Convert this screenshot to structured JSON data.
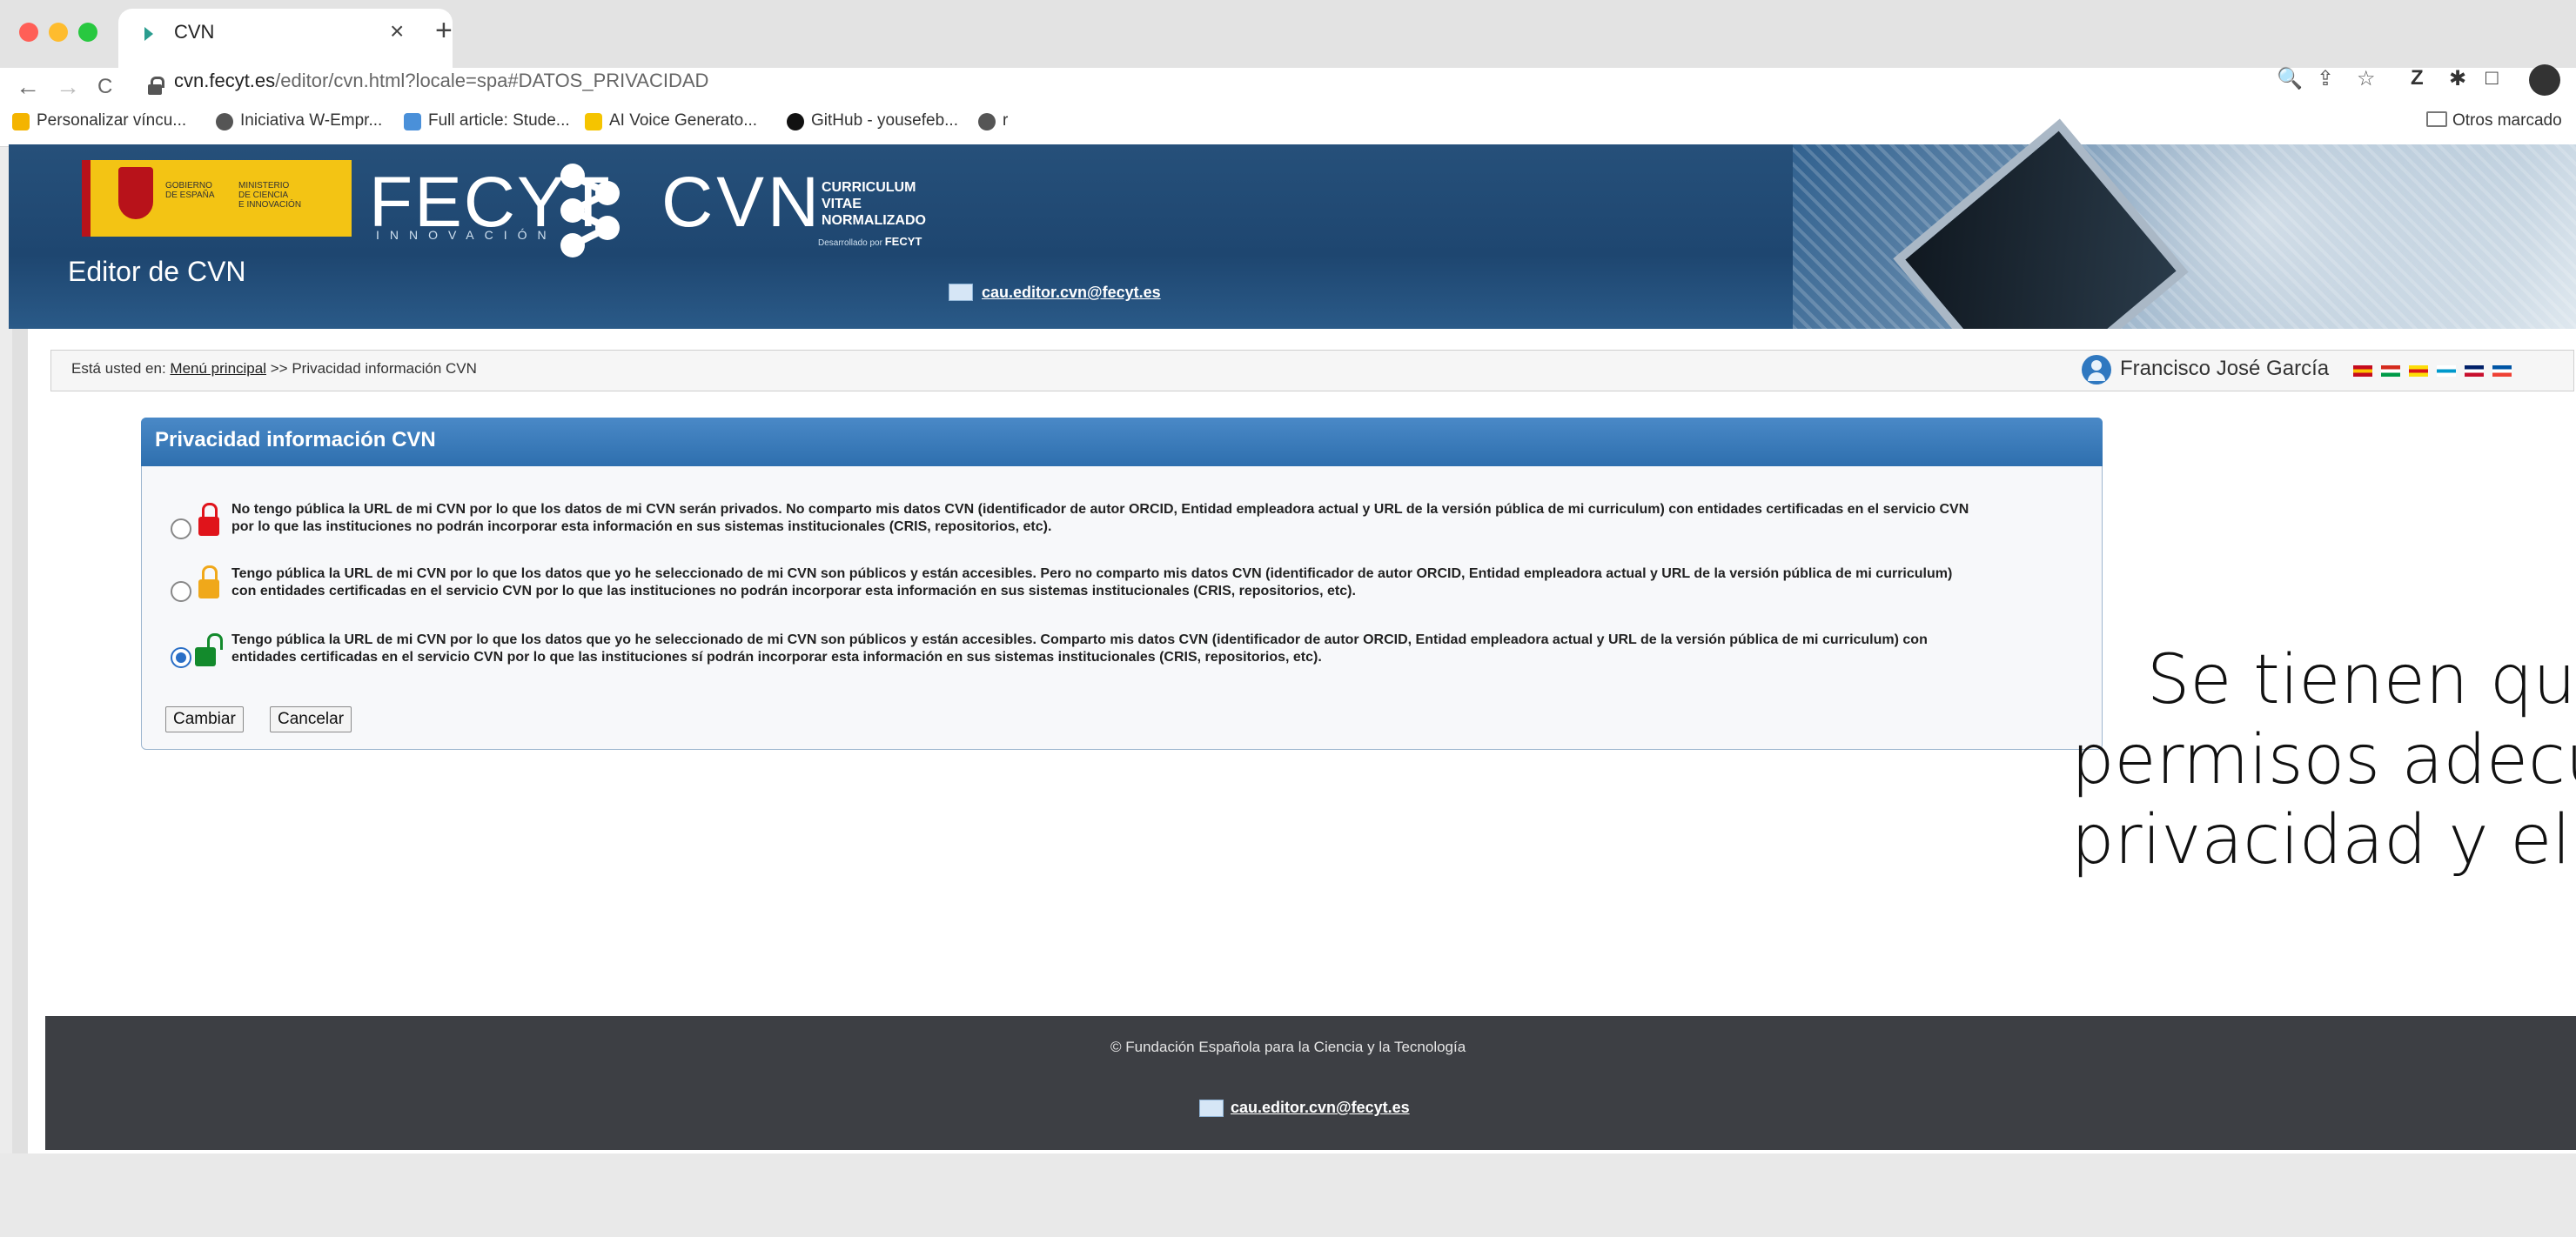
{
  "browser": {
    "tab_title": "CVN",
    "tab_close": "×",
    "tab_new": "+",
    "nav_back": "←",
    "nav_forward": "→",
    "nav_reload": "C",
    "url_domain": "cvn.fecyt.es",
    "url_path": "/editor/cvn.html?locale=spa#DATOS_PRIVACIDAD",
    "toolbar_icons": [
      "search-icon",
      "share-icon",
      "star-icon",
      "extension-z-icon",
      "puzzle-icon",
      "window-icon",
      "profile-icon"
    ],
    "toolbar_glyphs": {
      "search": "🔍",
      "share": "⇪",
      "star": "☆",
      "z": "Z",
      "puzzle": "✱",
      "window": "□"
    },
    "bookmarks": [
      {
        "label": "Personalizar víncu...",
        "icon": "apps-grid-icon",
        "color": "#f4b400"
      },
      {
        "label": "Iniciativa W-Empr...",
        "icon": "globe-icon",
        "color": "#555555"
      },
      {
        "label": "Full article: Stude...",
        "icon": "article-icon",
        "color": "#4a90d9"
      },
      {
        "label": "AI Voice Generato...",
        "icon": "voice-icon",
        "color": "#f5c400"
      },
      {
        "label": "GitHub - yousefeb...",
        "icon": "github-icon",
        "color": "#111111"
      },
      {
        "label": "r",
        "icon": "globe-icon",
        "color": "#555555"
      }
    ],
    "other_bookmarks": "Otros marcado"
  },
  "header": {
    "gov_text_1": "GOBIERNO\nDE ESPAÑA",
    "gov_text_2": "MINISTERIO\nDE CIENCIA\nE INNOVACIÓN",
    "fecyt": "FECYT",
    "fecyt_sub": "INNOVACIÓN",
    "cvn": "CVN",
    "cvn_words": "CURRICULUM\nVITAE\nNORMALIZADO",
    "cvn_dev_prefix": "Desarrollado por",
    "cvn_dev_brand": "FECYT",
    "editor_title": "Editor de CVN",
    "email": "cau.editor.cvn@fecyt.es"
  },
  "breadcrumb": {
    "prefix": "Está usted en:",
    "home": "Menú principal",
    "separator": ">>",
    "current": "Privacidad información CVN"
  },
  "user": {
    "name": "Francisco José García",
    "languages": [
      {
        "code": "es",
        "colors": [
          "#c60b1e",
          "#ffc400",
          "#c60b1e"
        ]
      },
      {
        "code": "eu",
        "colors": [
          "#d52b1e",
          "#ffffff",
          "#009b48"
        ]
      },
      {
        "code": "ca",
        "colors": [
          "#fcdd09",
          "#da121a",
          "#fcdd09"
        ]
      },
      {
        "code": "gl",
        "colors": [
          "#ffffff",
          "#0099cc",
          "#ffffff"
        ]
      },
      {
        "code": "en",
        "colors": [
          "#012169",
          "#ffffff",
          "#c8102e"
        ]
      },
      {
        "code": "fr",
        "colors": [
          "#0055a4",
          "#ffffff",
          "#ef4135"
        ]
      }
    ]
  },
  "privacy": {
    "title": "Privacidad información CVN",
    "options": [
      {
        "lock": "red",
        "selected": false,
        "text": "No tengo pública la URL de mi CVN por lo que los datos de mi CVN serán privados. No comparto mis datos CVN (identificador de autor ORCID, Entidad empleadora actual y URL de la versión pública de mi curriculum) con entidades certificadas en el servicio CVN por lo que las instituciones no podrán incorporar esta información en sus sistemas institucionales (CRIS, repositorios, etc)."
      },
      {
        "lock": "orange",
        "selected": false,
        "text": "Tengo pública la URL de mi CVN por lo que los datos que yo he seleccionado de mi CVN son públicos y están accesibles. Pero no comparto mis datos CVN (identificador de autor ORCID, Entidad empleadora actual y URL de la versión pública de mi curriculum) con entidades certificadas en el servicio CVN por lo que las instituciones no podrán incorporar esta información en sus sistemas institucionales (CRIS, repositorios, etc)."
      },
      {
        "lock": "green",
        "selected": true,
        "text": "Tengo pública la URL de mi CVN por lo que los datos que yo he seleccionado de mi CVN son públicos y están accesibles. Comparto mis datos CVN (identificador de autor ORCID, Entidad empleadora actual y URL de la versión pública de mi curriculum) con entidades certificadas en el servicio CVN por lo que las instituciones sí podrán incorporar esta información en sus sistemas institucionales (CRIS, repositorios, etc)."
      }
    ],
    "change_label": "Cambiar",
    "cancel_label": "Cancelar"
  },
  "overlay": {
    "lines": [
      "Se tienen qu",
      "permisos adecu",
      "privacidad y el O"
    ]
  },
  "footer": {
    "copyright": "© Fundación Española para la Ciencia y la Tecnología",
    "email": "cau.editor.cvn@fecyt.es"
  }
}
